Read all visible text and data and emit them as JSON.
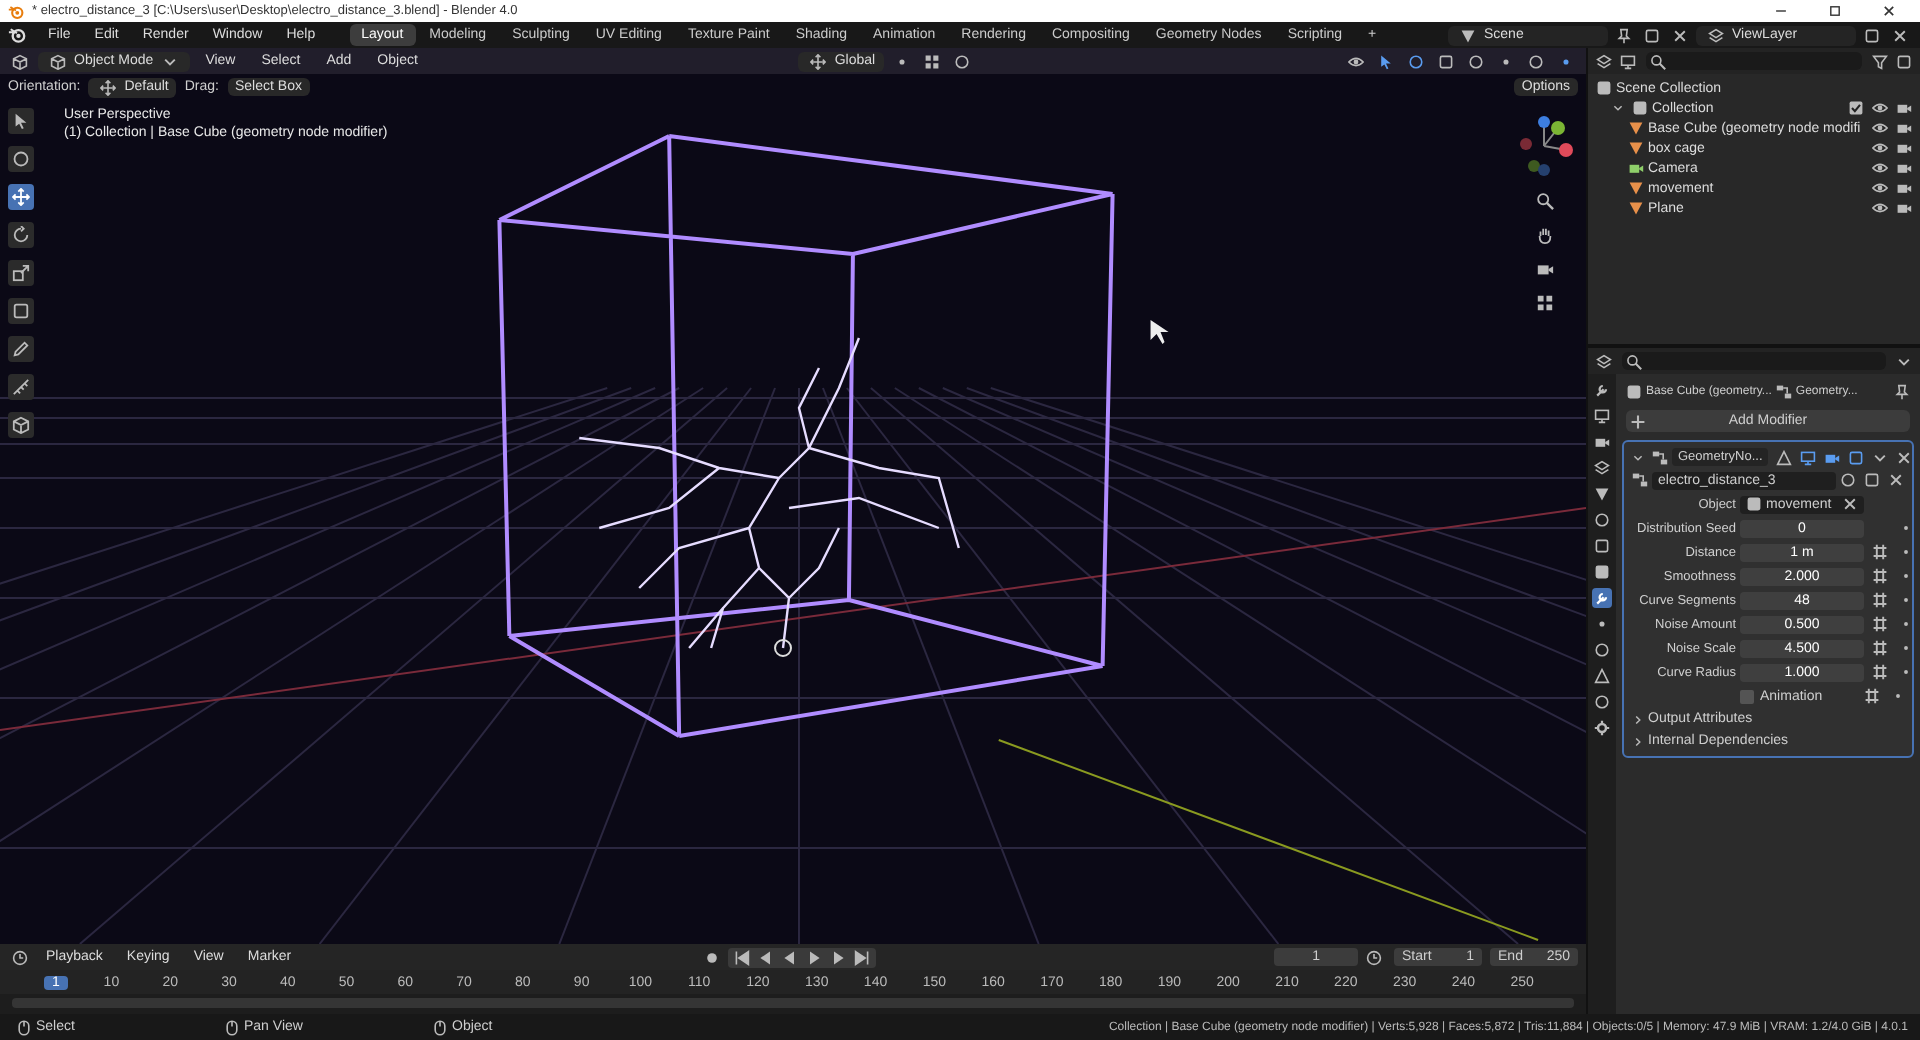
{
  "window": {
    "title": "* electro_distance_3 [C:\\Users\\user\\Desktop\\electro_distance_3.blend] - Blender 4.0"
  },
  "menu": [
    "File",
    "Edit",
    "Render",
    "Window",
    "Help"
  ],
  "workspaces": [
    {
      "label": "Layout",
      "selected": true
    },
    {
      "label": "Modeling",
      "selected": false
    },
    {
      "label": "Sculpting",
      "selected": false
    },
    {
      "label": "UV Editing",
      "selected": false
    },
    {
      "label": "Texture Paint",
      "selected": false
    },
    {
      "label": "Shading",
      "selected": false
    },
    {
      "label": "Animation",
      "selected": false
    },
    {
      "label": "Rendering",
      "selected": false
    },
    {
      "label": "Compositing",
      "selected": false
    },
    {
      "label": "Geometry Nodes",
      "selected": false
    },
    {
      "label": "Scripting",
      "selected": false
    }
  ],
  "add_workspace": "+",
  "scene": "Scene",
  "view_layer": "ViewLayer",
  "viewport": {
    "mode": "Object Mode",
    "menus": [
      "View",
      "Select",
      "Add",
      "Object"
    ],
    "transform": "Global",
    "orientation_label": "Orientation:",
    "orientation": "Default",
    "drag_label": "Drag:",
    "drag": "Select Box",
    "options": "Options",
    "info": [
      "User Perspective",
      "(1) Collection | Base Cube (geometry node modifier)"
    ]
  },
  "outliner": {
    "items": [
      {
        "label": "Scene Collection",
        "kind": "scene",
        "children": [
          {
            "label": "Collection",
            "kind": "collection",
            "expanded": true,
            "children": [
              {
                "label": "Base Cube (geometry node modifi",
                "kind": "mesh"
              },
              {
                "label": "box cage",
                "kind": "mesh"
              },
              {
                "label": "Camera",
                "kind": "camera"
              },
              {
                "label": "movement",
                "kind": "mesh"
              },
              {
                "label": "Plane",
                "kind": "mesh"
              }
            ]
          }
        ]
      }
    ]
  },
  "properties": {
    "breadcrumb": [
      "Base Cube (geometry...",
      "Geometry..."
    ],
    "add_modifier": "Add Modifier",
    "modifier": {
      "name": "GeometryNo...",
      "expanded": true,
      "node_group": "electro_distance_3",
      "fields": [
        {
          "kind": "object",
          "label": "Object",
          "value": "movement"
        },
        {
          "kind": "number",
          "label": "Distribution Seed",
          "value": "0"
        },
        {
          "kind": "linked",
          "label": "Distance",
          "value": "1 m"
        },
        {
          "kind": "linked",
          "label": "Smoothness",
          "value": "2.000"
        },
        {
          "kind": "linked",
          "label": "Curve Segments",
          "value": "48"
        },
        {
          "kind": "linked",
          "label": "Noise Amount",
          "value": "0.500"
        },
        {
          "kind": "linked",
          "label": "Noise Scale",
          "value": "4.500"
        },
        {
          "kind": "linked",
          "label": "Curve Radius",
          "value": "1.000"
        },
        {
          "kind": "checkbox",
          "label": "Animation",
          "checked": false
        }
      ],
      "sections": [
        {
          "label": "Output Attributes",
          "expanded": false
        },
        {
          "label": "Internal Dependencies",
          "expanded": false
        }
      ]
    }
  },
  "timeline": {
    "menus": [
      "Playback",
      "Keying",
      "View",
      "Marker"
    ],
    "frame": "1",
    "start_label": "Start",
    "start": "1",
    "end_label": "End",
    "end": "250",
    "current": "1",
    "ticks": [
      "10",
      "20",
      "30",
      "40",
      "50",
      "60",
      "70",
      "80",
      "90",
      "100",
      "110",
      "120",
      "130",
      "140",
      "150",
      "160",
      "170",
      "180",
      "190",
      "200",
      "210",
      "220",
      "230",
      "240",
      "250"
    ]
  },
  "status_bar": {
    "hints": [
      "Select",
      "Pan View",
      "Object"
    ],
    "stats": "Collection | Base Cube (geometry node modifier) | Verts:5,928 | Faces:5,872 | Tris:11,884 | Objects:0/5 | Memory: 47.9 MiB | VRAM: 1.2/4.0 GiB | 4.0.1"
  }
}
